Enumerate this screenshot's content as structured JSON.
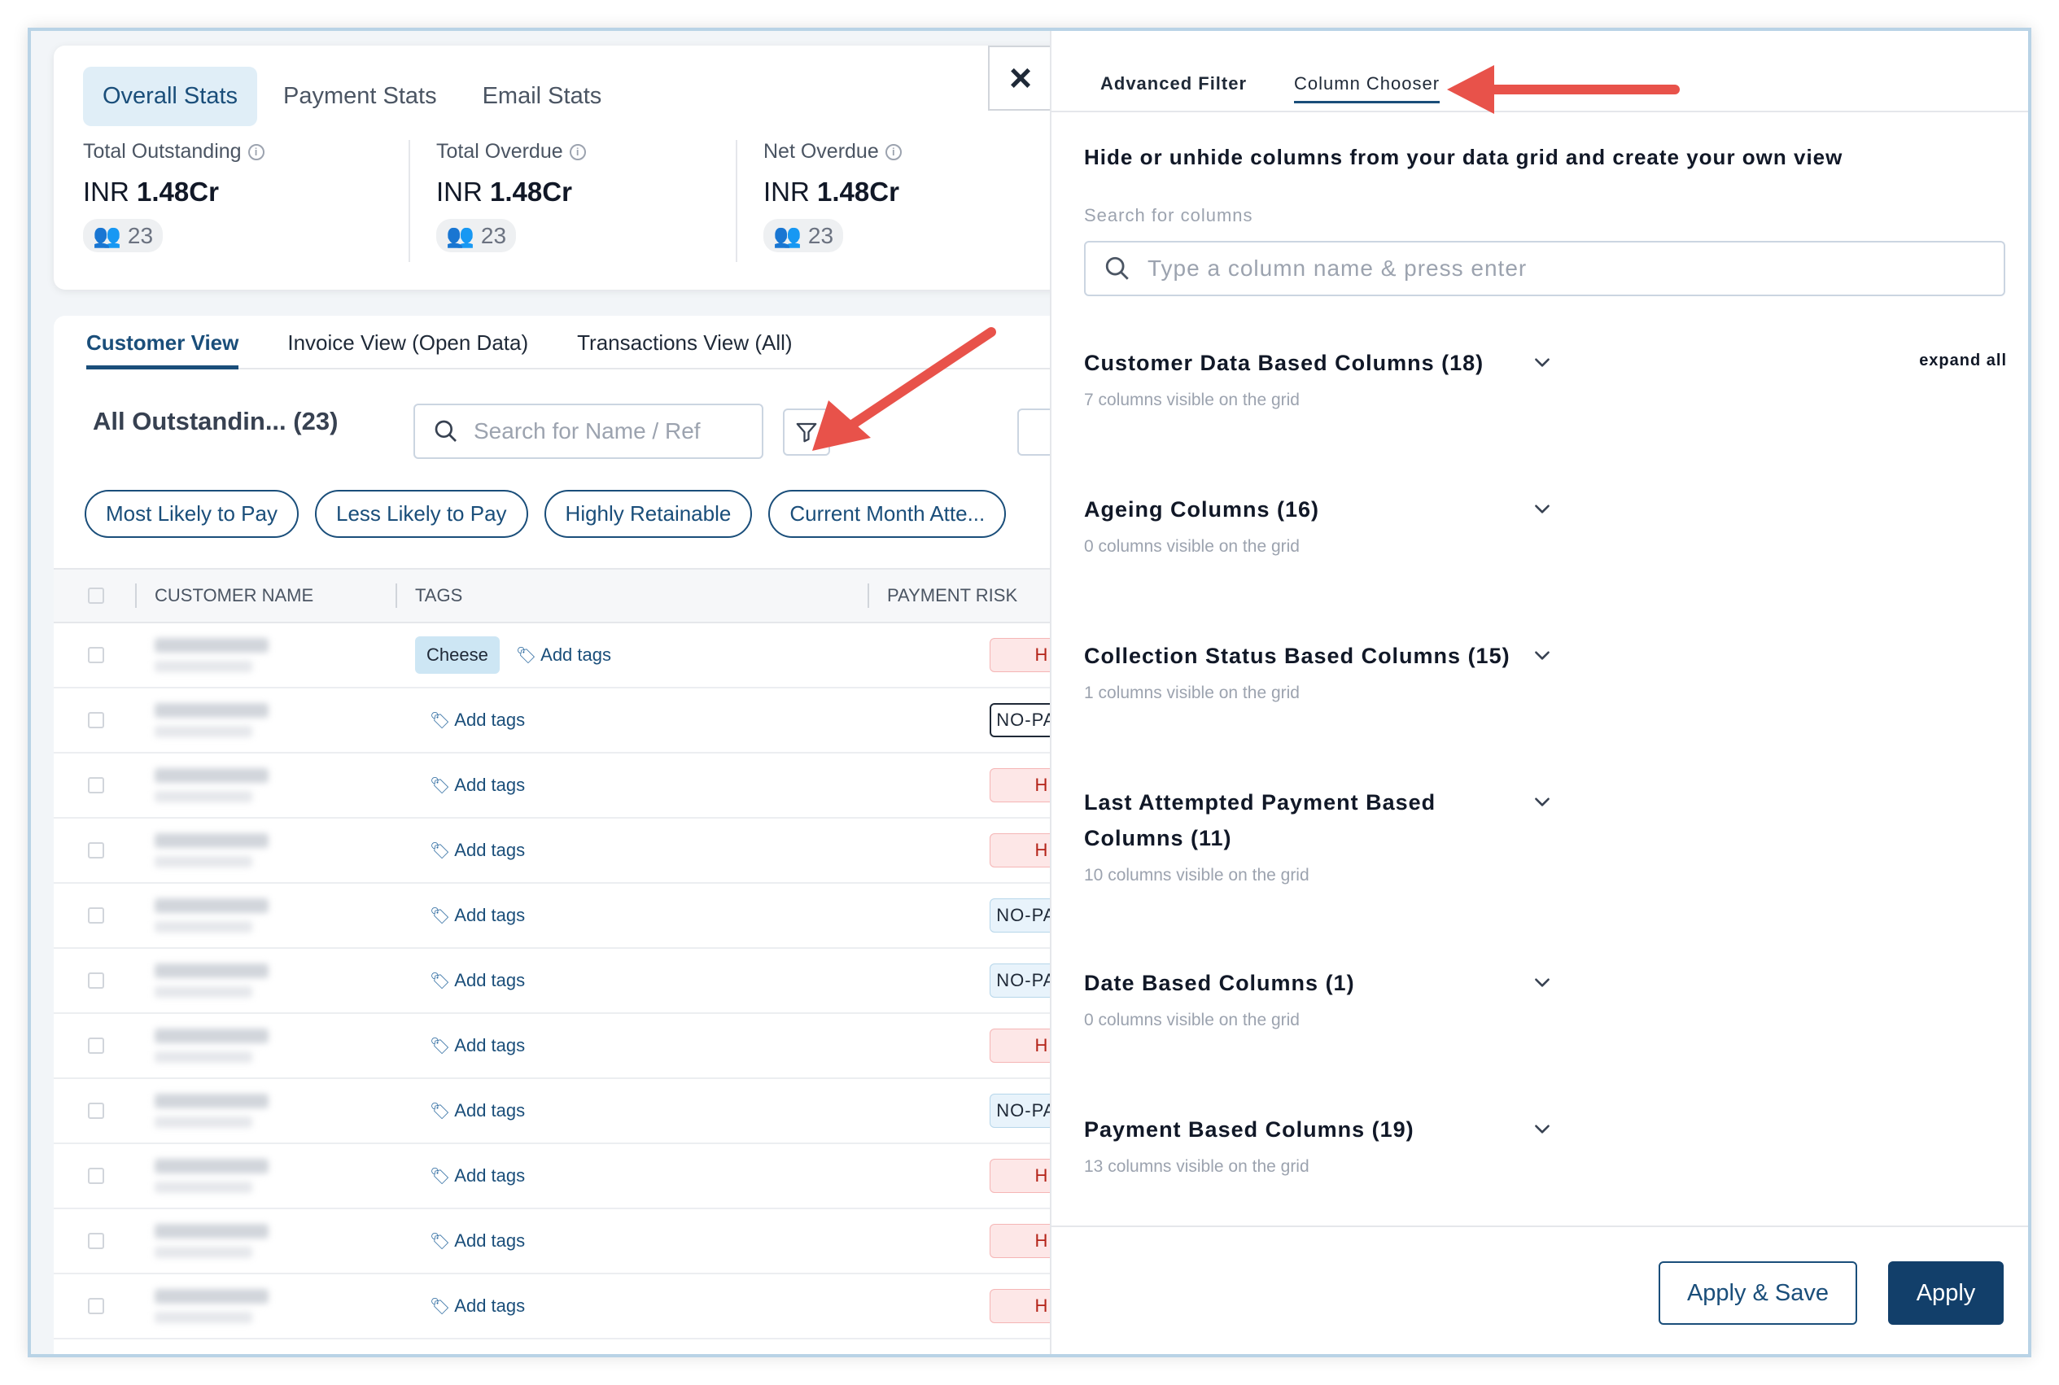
{
  "stats": {
    "tabs": [
      "Overall Stats",
      "Payment Stats",
      "Email Stats"
    ],
    "blocks": [
      {
        "title": "Total Outstanding",
        "currency": "INR",
        "amount": "1.48Cr",
        "count": "23"
      },
      {
        "title": "Total Overdue",
        "currency": "INR",
        "amount": "1.48Cr",
        "count": "23"
      },
      {
        "title": "Net Overdue",
        "currency": "INR",
        "amount": "1.48Cr",
        "count": "23"
      }
    ]
  },
  "close_icon": "×",
  "views": {
    "tabs": [
      "Customer View",
      "Invoice View (Open Data)",
      "Transactions View (All)"
    ]
  },
  "list": {
    "title": "All Outstandin... (23)",
    "search_placeholder": "Search for Name / Ref",
    "chips": [
      "Most Likely to Pay",
      "Less Likely to Pay",
      "Highly Retainable",
      "Current Month Atte..."
    ]
  },
  "grid": {
    "headers": [
      "CUSTOMER NAME",
      "TAGS",
      "PAYMENT RISK"
    ],
    "rows": [
      {
        "tag": "Cheese",
        "add_tags": "Add tags",
        "risk": "HIGH"
      },
      {
        "tag": "",
        "add_tags": "Add tags",
        "risk": "NO-PAYMENT"
      },
      {
        "tag": "",
        "add_tags": "Add tags",
        "risk": "HIGH"
      },
      {
        "tag": "",
        "add_tags": "Add tags",
        "risk": "HIGH"
      },
      {
        "tag": "",
        "add_tags": "Add tags",
        "risk": "NO-PAYMENT"
      },
      {
        "tag": "",
        "add_tags": "Add tags",
        "risk": "NO-PAYMENT"
      },
      {
        "tag": "",
        "add_tags": "Add tags",
        "risk": "HIGH"
      },
      {
        "tag": "",
        "add_tags": "Add tags",
        "risk": "NO-PAYMENT"
      },
      {
        "tag": "",
        "add_tags": "Add tags",
        "risk": "HIGH"
      },
      {
        "tag": "",
        "add_tags": "Add tags",
        "risk": "HIGH"
      },
      {
        "tag": "",
        "add_tags": "Add tags",
        "risk": "HIGH"
      }
    ]
  },
  "panel": {
    "tabs": {
      "advanced": "Advanced Filter",
      "columns": "Column Chooser"
    },
    "description": "Hide or unhide columns from your data grid and create your own view",
    "search_label": "Search for columns",
    "search_placeholder": "Type a column name & press enter",
    "expand_all": "expand all",
    "groups": [
      {
        "title": "Customer Data Based Columns (18)",
        "sub": "7 columns visible on the grid"
      },
      {
        "title": "Ageing Columns (16)",
        "sub": "0 columns visible on the grid"
      },
      {
        "title": "Collection Status Based Columns (15)",
        "sub": "1 columns visible on the grid"
      },
      {
        "title": "Last Attempted Payment Based Columns (11)",
        "sub": "10 columns visible on the grid"
      },
      {
        "title": "Date Based Columns (1)",
        "sub": "0 columns visible on the grid"
      },
      {
        "title": "Payment Based Columns (19)",
        "sub": "13 columns visible on the grid"
      }
    ],
    "apply_save": "Apply & Save",
    "apply": "Apply"
  },
  "colors": {
    "accent": "#1a4e7a",
    "annotation_arrow": "#e8524a",
    "high_risk": "#b42318"
  }
}
